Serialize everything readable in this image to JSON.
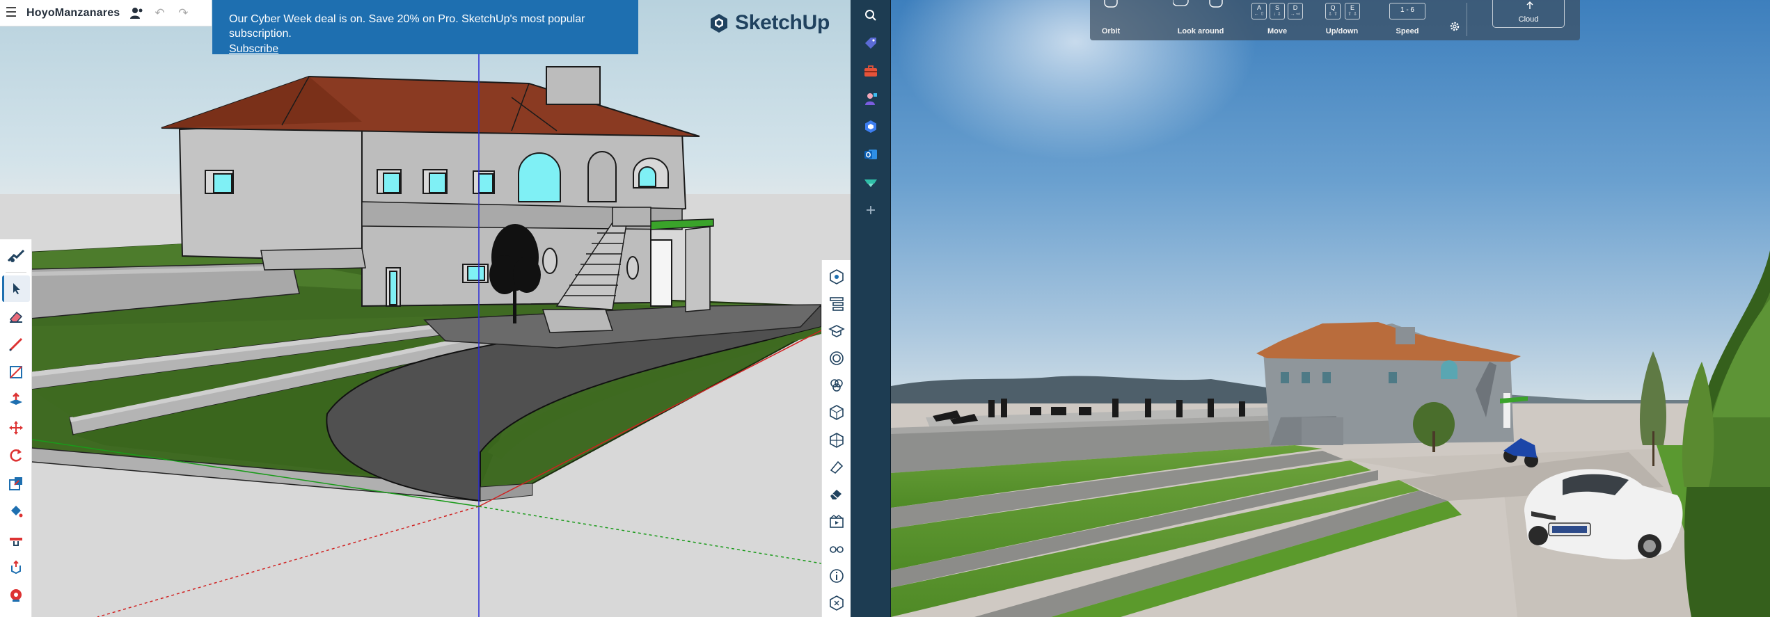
{
  "app": {
    "project_name": "HoyoManzanares",
    "brand": "SketchUp"
  },
  "promo": {
    "message": "Our Cyber Week deal is on. Save 20% on Pro. SketchUp's most popular subscription.",
    "link": "Subscribe"
  },
  "topbar_icons": [
    "menu-icon",
    "user-settings-icon",
    "undo-icon",
    "redo-icon"
  ],
  "left_tools": [
    "search-tool-icon",
    "select-icon",
    "eraser-icon",
    "pencil-icon",
    "rectangle-icon",
    "push-pull-icon",
    "move-icon",
    "rotate-icon",
    "scale-icon",
    "paint-bucket-icon",
    "tape-measure-icon",
    "orbit-icon",
    "walk-icon"
  ],
  "right_panel_icons": [
    "entity-info-icon",
    "outliner-icon",
    "instructor-icon",
    "materials-icon",
    "components-icon",
    "styles-icon",
    "tags-icon",
    "soften-edges-icon",
    "scenes-icon",
    "display-icon",
    "info-icon",
    "extensions-icon"
  ],
  "sidebar_icons": [
    "search-icon",
    "tag-icon",
    "toolbox-icon",
    "user-icon",
    "extension-icon",
    "outlook-icon",
    "render-icon",
    "add-icon"
  ],
  "hud": {
    "orbit": "Orbit",
    "look_around": "Look around",
    "move": "Move",
    "updown": "Up/down",
    "speed": "Speed",
    "speed_value": "1 - 6",
    "cloud": "Cloud",
    "move_keys": [
      {
        "k": "A",
        "s": "← ⇧"
      },
      {
        "k": "S",
        "s": "↓ ⇩"
      },
      {
        "k": "D",
        "s": "→ ⇨"
      }
    ],
    "updown_keys": [
      {
        "k": "Q",
        "s": "⇩ ⇧"
      },
      {
        "k": "E",
        "s": "⇧ ⇩"
      }
    ]
  },
  "colors": {
    "promo": "#1e6fb0",
    "sidebar": "#1d3c52",
    "roof": "#8a3a22",
    "grass": "#3d6b1f"
  }
}
